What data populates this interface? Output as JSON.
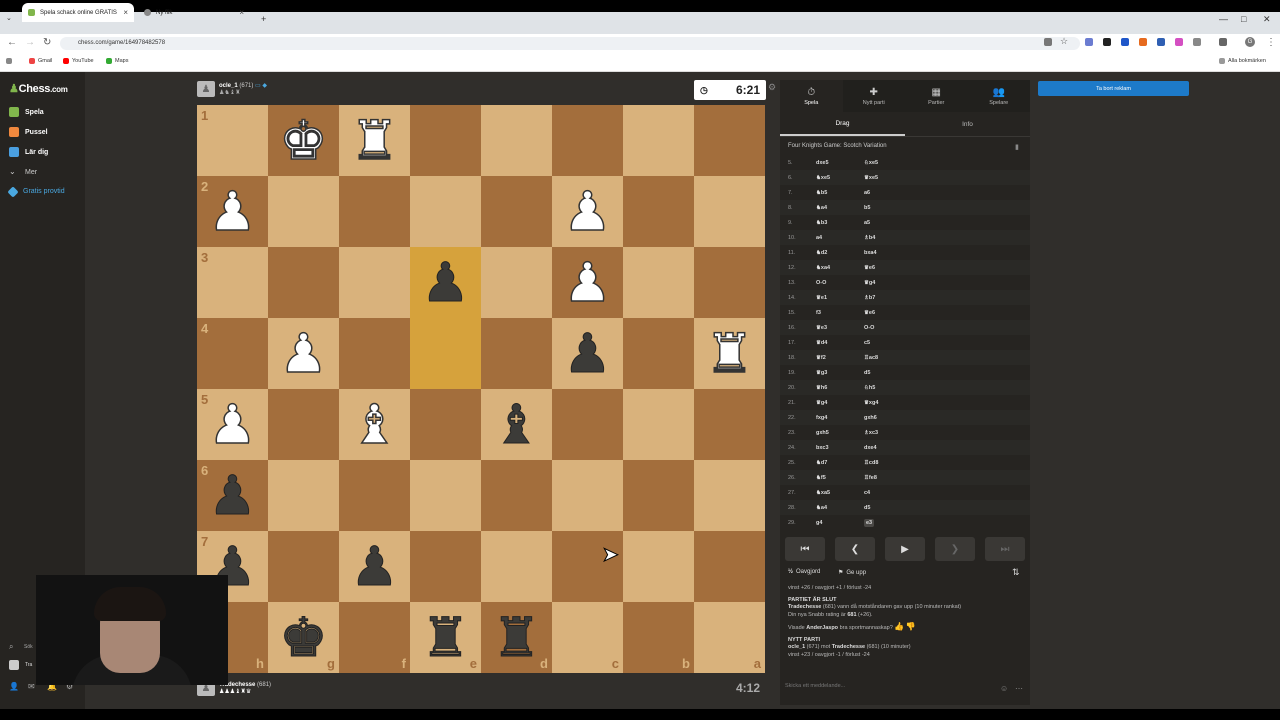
{
  "browser": {
    "tabs": [
      {
        "title": "Spela schack online GRATIS"
      },
      {
        "title": "Ny flik"
      }
    ],
    "new_tab": "+",
    "url": "chess.com/game/164978482578",
    "bookmarks": [
      "Gmail",
      "YouTube",
      "Maps"
    ],
    "all_bookmarks": "Alla bokmärken",
    "profile_initial": "G"
  },
  "sidebar": {
    "logo_prefix": "♟",
    "logo": "Chess",
    "logo_suffix": ".com",
    "items": [
      {
        "label": "Spela"
      },
      {
        "label": "Pussel"
      },
      {
        "label": "Lär dig"
      },
      {
        "label": "Mer"
      },
      {
        "label": "Gratis provtid"
      }
    ],
    "search": "Sök",
    "user": "Tra"
  },
  "top_player": {
    "name": "ocle_1",
    "rating": "(671)",
    "captured": "♟♞♝♜"
  },
  "bottom_player": {
    "name": "Tradechesse",
    "rating": "(681)",
    "captured": "♟♟♟♝♜♛"
  },
  "clocks": {
    "top": "6:21",
    "bottom": "4:12"
  },
  "board": {
    "ranks": [
      "1",
      "2",
      "3",
      "4",
      "5",
      "6",
      "7",
      "8"
    ],
    "files": [
      "h",
      "g",
      "f",
      "e",
      "d",
      "c",
      "b",
      "a"
    ],
    "rows": [
      [
        "",
        "K",
        "R",
        "",
        "",
        "",
        "",
        ""
      ],
      [
        "P",
        "",
        "",
        "",
        "",
        "P",
        "",
        ""
      ],
      [
        "",
        "",
        "",
        "p",
        "",
        "P",
        "",
        ""
      ],
      [
        "",
        "P",
        "",
        "",
        "",
        "p",
        "",
        "R"
      ],
      [
        "P",
        "",
        "B",
        "",
        "b",
        "",
        "",
        ""
      ],
      [
        "p",
        "",
        "",
        "",
        "",
        "",
        "",
        ""
      ],
      [
        "p",
        "",
        "p",
        "",
        "",
        "",
        "",
        ""
      ],
      [
        "",
        "k",
        "",
        "r",
        "r",
        "",
        "",
        ""
      ]
    ],
    "highlight": [
      [
        2,
        3
      ],
      [
        3,
        3
      ]
    ]
  },
  "panel": {
    "tabs": [
      {
        "label": "Spela",
        "icon": "⏱"
      },
      {
        "label": "Nytt parti",
        "icon": "✚"
      },
      {
        "label": "Partier",
        "icon": "▦"
      },
      {
        "label": "Spelare",
        "icon": "👥"
      }
    ],
    "subtabs": [
      "Drag",
      "Info"
    ],
    "opening": "Four Knights Game: Scotch Variation",
    "moves": [
      {
        "n": "5.",
        "w": "dxe5",
        "b": "♘xe5"
      },
      {
        "n": "6.",
        "w": "♞xe5",
        "b": "♛xe5"
      },
      {
        "n": "7.",
        "w": "♞b5",
        "b": "a6"
      },
      {
        "n": "8.",
        "w": "♞a4",
        "b": "b5"
      },
      {
        "n": "9.",
        "w": "♞b3",
        "b": "a5"
      },
      {
        "n": "10.",
        "w": "a4",
        "b": "♗b4"
      },
      {
        "n": "11.",
        "w": "♞d2",
        "b": "bxa4"
      },
      {
        "n": "12.",
        "w": "♞xa4",
        "b": "♛e6"
      },
      {
        "n": "13.",
        "w": "O-O",
        "b": "♛g4"
      },
      {
        "n": "14.",
        "w": "♛e1",
        "b": "♗b7"
      },
      {
        "n": "15.",
        "w": "f3",
        "b": "♛e6"
      },
      {
        "n": "16.",
        "w": "♛e3",
        "b": "O-O"
      },
      {
        "n": "17.",
        "w": "♛d4",
        "b": "c5"
      },
      {
        "n": "18.",
        "w": "♛f2",
        "b": "♖ac8"
      },
      {
        "n": "19.",
        "w": "♛g3",
        "b": "d5"
      },
      {
        "n": "20.",
        "w": "♛h6",
        "b": "♘h5"
      },
      {
        "n": "21.",
        "w": "♛g4",
        "b": "♛xg4"
      },
      {
        "n": "22.",
        "w": "fxg4",
        "b": "gxh6"
      },
      {
        "n": "23.",
        "w": "gxh5",
        "b": "♗xc3"
      },
      {
        "n": "24.",
        "w": "bxc3",
        "b": "dxe4"
      },
      {
        "n": "25.",
        "w": "♞d7",
        "b": "♖cd8"
      },
      {
        "n": "26.",
        "w": "♞f5",
        "b": "♖fe8"
      },
      {
        "n": "27.",
        "w": "♞xa5",
        "b": "c4"
      },
      {
        "n": "28.",
        "w": "♞a4",
        "b": "d5"
      },
      {
        "n": "29.",
        "w": "g4",
        "b": "e3"
      }
    ],
    "controls": [
      "⏮",
      "❮",
      "▶",
      "❯",
      "⏭"
    ],
    "draw": "Oavgjord",
    "resign": "Ge upp",
    "chat": {
      "line1": "vinst +26 / oavgjort +1 / förlust -24",
      "over_title": "PARTIET ÄR SLUT",
      "over_winner": "Tradechesse",
      "over_text1": "(681) vann då motståndaren gav upp (10 minuter rankat)",
      "over_text2": "Din nya Snabb rating är",
      "over_rating": "681",
      "over_text3": "(+26).",
      "sport_pre": "Visade",
      "sport_name": "AnderJaspo",
      "sport_post": "bra sportmannaskap?",
      "new_title": "NYTT PARTI",
      "new_line_a": "ocle_1",
      "new_line_b": "(671) mot",
      "new_line_c": "Tradechesse",
      "new_line_d": "(681) (10 minuter)",
      "new_line2": "vinst +23 / oavgjort -1 / förlust -24"
    },
    "chat_placeholder": "Skicka ett meddelande..."
  },
  "ad_button": "Ta bort reklam"
}
